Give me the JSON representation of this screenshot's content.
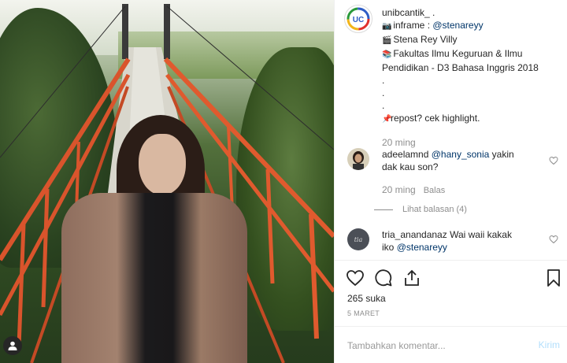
{
  "post": {
    "username": "unibcantik_",
    "caption_lines": [
      "inframe : ",
      "Stena Rey Villy",
      "Fakultas Ilmu Keguruan & Ilmu",
      "Pendidikan - D3 Bahasa Inggris 2018",
      ".",
      ".",
      ".",
      "repost? cek highlight."
    ],
    "inframe_mention": "@stenareyy",
    "suffix": " .",
    "time": "20 ming",
    "likes": "265 suka",
    "date": "5 MARET"
  },
  "comments": [
    {
      "username": "adeelamnd",
      "mention": "@hany_sonia",
      "text_after": " yakin",
      "text_line2": "dak kau son?",
      "time": "20 ming",
      "reply_label": "Balas",
      "view_replies": "Lihat balasan (4)"
    },
    {
      "username": "tria_anandanaz",
      "text": " Wai waii kakak",
      "text_line2": "iko ",
      "mention": "@stenareyy"
    }
  ],
  "add_comment": {
    "placeholder": "Tambahkan komentar...",
    "post_label": "Kirim"
  },
  "icons": {
    "uc_avatar": "uc-logo-icon",
    "like": "heart-icon",
    "comment": "comment-icon",
    "share": "share-icon",
    "save": "bookmark-icon",
    "user_tag": "user-tag-icon"
  },
  "colors": {
    "link": "#003569",
    "muted": "#8e8e8e",
    "post_button": "#b2dffc"
  }
}
